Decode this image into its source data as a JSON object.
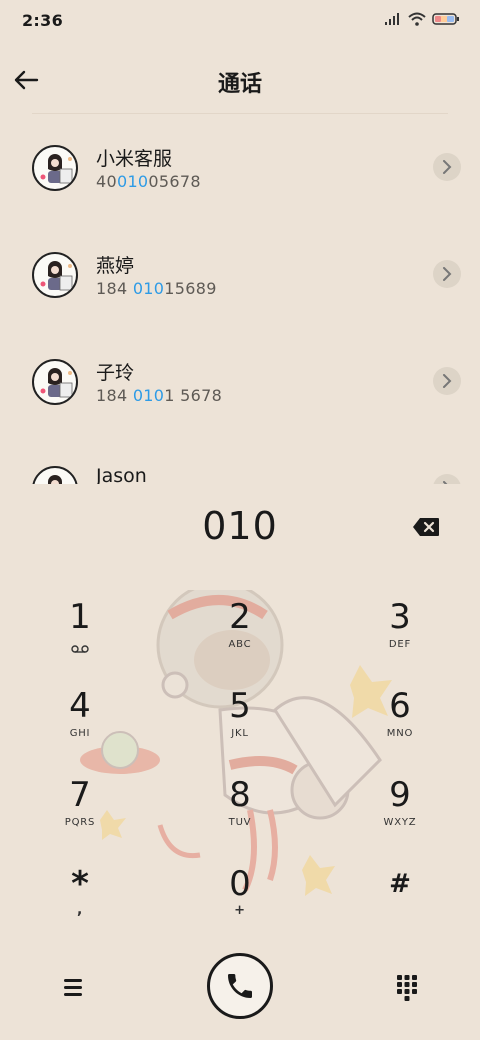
{
  "status_bar": {
    "time": "2:36",
    "icons": [
      "signal-icon",
      "wifi-icon",
      "battery-icon"
    ]
  },
  "header": {
    "title": "通话",
    "back_icon": "back-arrow-icon"
  },
  "contacts": [
    {
      "name": "小米客服",
      "number_pre": "40",
      "number_hl": "010",
      "number_post": "05678"
    },
    {
      "name": "燕婷",
      "number_pre": "184 ",
      "number_hl": "010",
      "number_post": "15689"
    },
    {
      "name": "子玲",
      "number_pre": "184 ",
      "number_hl": "010",
      "number_post": "1 5678"
    },
    {
      "name": "Jason",
      "number_pre": "",
      "number_hl": "",
      "number_post": ""
    }
  ],
  "dialer": {
    "dialed_number": "010",
    "keys": [
      {
        "digit": "1",
        "letters": ""
      },
      {
        "digit": "2",
        "letters": "ABC"
      },
      {
        "digit": "3",
        "letters": "DEF"
      },
      {
        "digit": "4",
        "letters": "GHI"
      },
      {
        "digit": "5",
        "letters": "JKL"
      },
      {
        "digit": "6",
        "letters": "MNO"
      },
      {
        "digit": "7",
        "letters": "PQRS"
      },
      {
        "digit": "8",
        "letters": "TUV"
      },
      {
        "digit": "9",
        "letters": "WXYZ"
      },
      {
        "digit": "*",
        "letters": ","
      },
      {
        "digit": "0",
        "letters": "+"
      },
      {
        "digit": "#",
        "letters": ""
      }
    ]
  },
  "bottom_bar": {
    "menu_icon": "hamburger-menu-icon",
    "call_icon": "phone-icon",
    "keypad_icon": "dialpad-icon"
  },
  "colors": {
    "background": "#ede3d7",
    "highlight": "#2e9be6",
    "text": "#1a1a1a"
  }
}
